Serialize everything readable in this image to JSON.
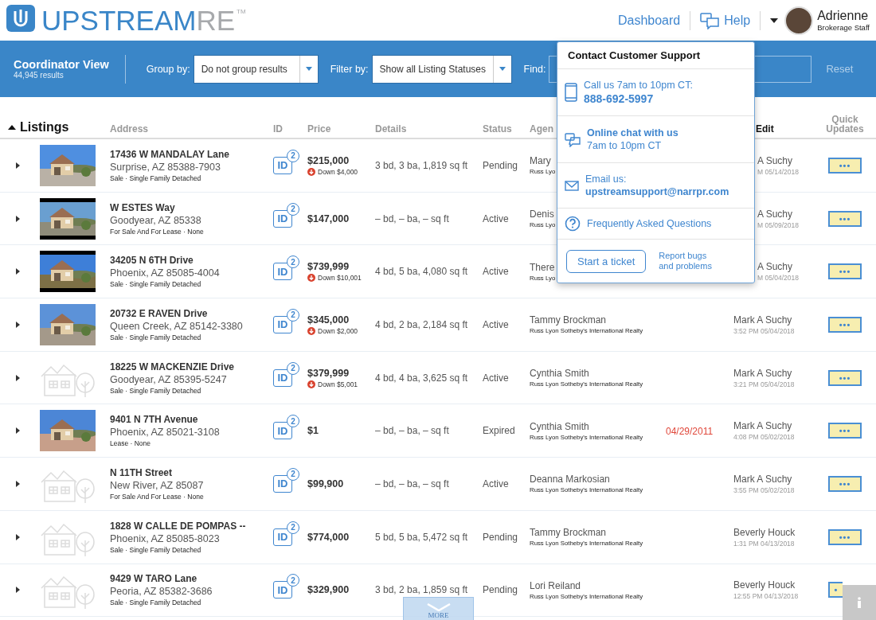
{
  "header": {
    "logo_main": "UPSTREAM",
    "logo_accent": "RE",
    "logo_tm": "TM",
    "nav": {
      "dashboard": "Dashboard",
      "help": "Help"
    },
    "user": {
      "name": "Adrienne",
      "role": "Brokerage Staff"
    }
  },
  "toolbar": {
    "title": "Coordinator View",
    "results": "44,945 results",
    "group_label": "Group by:",
    "group_value": "Do not group results",
    "filter_label": "Filter by:",
    "filter_value": "Show all Listing Statuses",
    "find_label": "Find:",
    "reset": "Reset"
  },
  "table": {
    "title": "Listings",
    "columns": [
      "Address",
      "ID",
      "Price",
      "Details",
      "Status",
      "Agen",
      "Edit",
      "Quick Updates"
    ],
    "rows": [
      {
        "street": "17436 W MANDALAY Lane",
        "city": "Surprise, AZ 85388-7903",
        "type": "Sale · Single Family Detached",
        "id_label": "ID",
        "id_count": "2",
        "price": "$215,000",
        "price_change": "Down $4,000",
        "details": "3 bd, 3 ba, 1,819 sq ft",
        "status": "Pending",
        "agent": "Mary",
        "agency": "Russ Lyo",
        "editor": "A Suchy",
        "edited": "M 05/14/2018",
        "quick": "•••"
      },
      {
        "street": "W ESTES Way",
        "city": "Goodyear, AZ 85338",
        "type": "For Sale And For Lease · None",
        "id_label": "ID",
        "id_count": "2",
        "price": "$147,000",
        "details": "– bd, – ba, – sq ft",
        "status": "Active",
        "agent": "Denis",
        "agency": "Russ Lyo",
        "editor": "A Suchy",
        "edited": "M 05/09/2018",
        "quick": "•••"
      },
      {
        "street": "34205 N 6TH Drive",
        "city": "Phoenix, AZ 85085-4004",
        "type": "Sale · Single Family Detached",
        "id_label": "ID",
        "id_count": "2",
        "price": "$739,999",
        "price_change": "Down $10,001",
        "details": "4 bd, 5 ba, 4,080 sq ft",
        "status": "Active",
        "agent": "There",
        "agency": "Russ Lyo",
        "editor": "A Suchy",
        "edited": "M 05/04/2018",
        "quick": "•••"
      },
      {
        "street": "20732 E RAVEN Drive",
        "city": "Queen Creek, AZ 85142-3380",
        "type": "Sale · Single Family Detached",
        "id_label": "ID",
        "id_count": "2",
        "price": "$345,000",
        "price_change": "Down $2,000",
        "details": "4 bd, 2 ba, 2,184 sq ft",
        "status": "Active",
        "agent": "Tammy Brockman",
        "agency": "Russ Lyon Sotheby's International Realty",
        "editor": "Mark A Suchy",
        "edited": "3:52 PM 05/04/2018",
        "quick": "•••"
      },
      {
        "kind": "placeholder",
        "street": "18225 W MACKENZIE Drive",
        "city": "Goodyear, AZ 85395-5247",
        "type": "Sale · Single Family Detached",
        "id_label": "ID",
        "id_count": "2",
        "price": "$379,999",
        "price_change": "Down $5,001",
        "details": "4 bd, 4 ba, 3,625 sq ft",
        "status": "Active",
        "agent": "Cynthia Smith",
        "agency": "Russ Lyon Sotheby's International Realty",
        "editor": "Mark A Suchy",
        "edited": "3:21 PM 05/04/2018",
        "quick": "•••"
      },
      {
        "street": "9401 N 7TH Avenue",
        "city": "Phoenix, AZ 85021-3108",
        "type": "Lease · None",
        "id_label": "ID",
        "id_count": "2",
        "price": "$1",
        "details": "– bd, – ba, – sq ft",
        "status": "Expired",
        "agent": "Cynthia Smith",
        "agency": "Russ Lyon Sotheby's International Realty",
        "expiration": "04/29/2011",
        "editor": "Mark A Suchy",
        "edited": "4:08 PM 05/02/2018",
        "quick": "•••"
      },
      {
        "kind": "placeholder",
        "street": "N 11TH Street",
        "city": "New River, AZ 85087",
        "type": "For Sale And For Lease · None",
        "id_label": "ID",
        "id_count": "2",
        "price": "$99,900",
        "details": "– bd, – ba, – sq ft",
        "status": "Active",
        "agent": "Deanna Markosian",
        "agency": "Russ Lyon Sotheby's International Realty",
        "editor": "Mark A Suchy",
        "edited": "3:55 PM 05/02/2018",
        "quick": "•••"
      },
      {
        "kind": "placeholder",
        "street": "1828 W CALLE DE POMPAS --",
        "city": "Phoenix, AZ 85085-8023",
        "type": "Sale · Single Family Detached",
        "id_label": "ID",
        "id_count": "2",
        "price": "$774,000",
        "details": "5 bd, 5 ba, 5,472 sq ft",
        "status": "Pending",
        "agent": "Tammy Brockman",
        "agency": "Russ Lyon Sotheby's International Realty",
        "editor": "Beverly Houck",
        "edited": "1:31 PM 04/13/2018",
        "quick": "•••"
      },
      {
        "kind": "placeholder",
        "street": "9429 W TARO Lane",
        "city": "Peoria, AZ 85382-3686",
        "type": "Sale · Single Family Detached",
        "id_label": "ID",
        "id_count": "2",
        "price": "$329,900",
        "details": "3 bd, 2 ba, 1,859 sq ft",
        "status": "Pending",
        "agent": "Lori Reiland",
        "agency": "Russ Lyon Sotheby's International Realty",
        "editor": "Beverly Houck",
        "edited": "12:55 PM 04/13/2018",
        "quick": "•"
      }
    ],
    "more_label": "MORE"
  },
  "support_popover": {
    "title": "Contact Customer Support",
    "items": [
      {
        "kind": "phone",
        "line1": "Call us 7am to 10pm CT:",
        "line2": "888-692-5997"
      },
      {
        "kind": "chat",
        "line1": "Online chat with us",
        "line2": "7am to 10pm CT"
      },
      {
        "kind": "email",
        "line1": "Email us:",
        "line2": "upstreamsupport@narrpr.com"
      },
      {
        "kind": "faq",
        "line1": "Frequently Asked Questions"
      }
    ],
    "ticket_button": "Start a ticket",
    "report_link": "Report bugs and problems"
  }
}
